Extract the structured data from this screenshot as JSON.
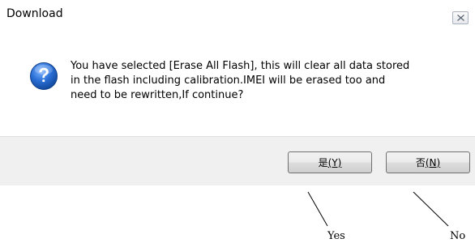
{
  "window": {
    "title": "Download",
    "close_icon": "close-icon"
  },
  "message": {
    "icon": "question-icon",
    "lines": [
      "You have selected [Erase All Flash], this will clear all data stored",
      "in the flash including calibration.IMEI will be erased too and",
      "need to be rewritten,If continue?"
    ]
  },
  "buttons": {
    "yes": {
      "label": "是",
      "mnemonic": "(Y)"
    },
    "no": {
      "label": "否",
      "mnemonic": "(N)"
    }
  },
  "annotations": {
    "yes_label": "Yes",
    "no_label": "No"
  },
  "colors": {
    "button_bar": "#f0f0f0",
    "icon_blue": "#2a6fd6",
    "close_border": "#a9b2bf"
  }
}
